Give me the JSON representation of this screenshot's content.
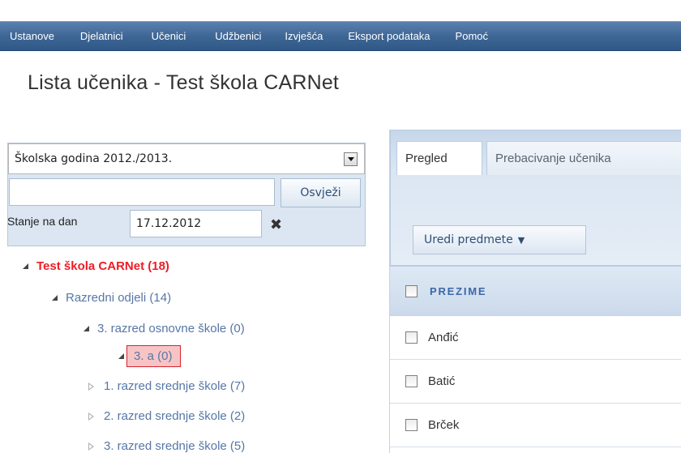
{
  "nav": {
    "items": [
      "Ustanove",
      "Djelatnici",
      "Učenici",
      "Udžbenici",
      "Izvješća",
      "Eksport podataka",
      "Pomoć"
    ]
  },
  "page": {
    "title": "Lista učenika - Test škola CARNet"
  },
  "filter": {
    "school_year": "Školska godina 2012./2013.",
    "search_value": "",
    "refresh_label": "Osvježi",
    "state_label": "Stanje na dan",
    "date_value": "17.12.2012",
    "clear_icon": "close-x-icon"
  },
  "tree": {
    "root": "Test škola CARNet (18)",
    "group": "Razredni odjeli (14)",
    "grade_primary": "3. razred osnovne škole (0)",
    "selected_class": "3. a (0)",
    "grade_sec_1": "1. razred srednje škole (7)",
    "grade_sec_2": "2. razred srednje škole (2)",
    "grade_sec_3": "3. razred srednje škole (5)"
  },
  "tabs": {
    "active": "Pregled",
    "inactive": "Prebacivanje učenika"
  },
  "toolbar": {
    "edit_subjects": "Uredi predmete",
    "dropdown_glyph": "▼"
  },
  "table": {
    "header": "PREZIME",
    "rows": [
      "Anđić",
      "Batić",
      "Brček"
    ]
  },
  "colors": {
    "nav_bg": "#3f6796",
    "root_red": "#ee1c25",
    "tree_blue": "#5677a6",
    "selection_bg": "#f7c4c5",
    "header_text": "#3a67a8"
  }
}
